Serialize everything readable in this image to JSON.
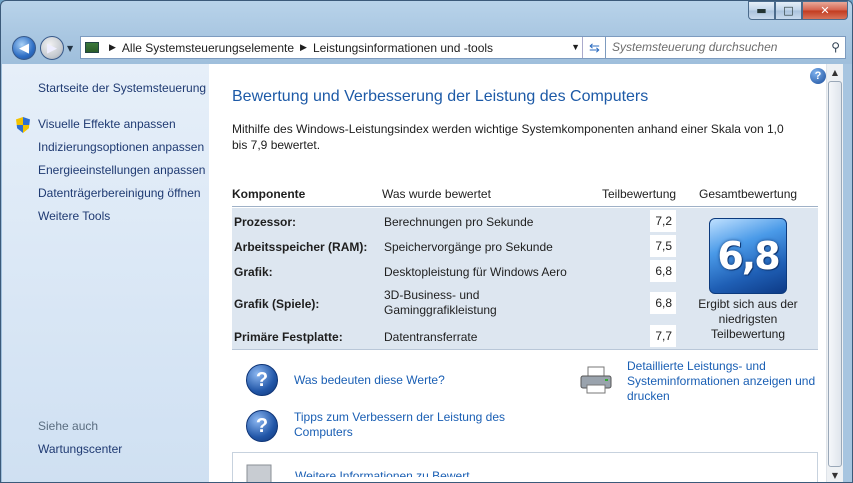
{
  "window": {
    "min": "▬",
    "max": "□",
    "close": "✕"
  },
  "nav": {
    "back_icon": "back-arrow-icon",
    "forward_icon": "forward-arrow-icon",
    "breadcrumb": [
      "Alle Systemsteuerungselemente",
      "Leistungsinformationen und -tools"
    ],
    "search_placeholder": "Systemsteuerung durchsuchen"
  },
  "sidebar": {
    "items": [
      {
        "label": "Startseite der Systemsteuerung"
      },
      {
        "label": "Visuelle Effekte anpassen"
      },
      {
        "label": "Indizierungsoptionen anpassen"
      },
      {
        "label": "Energieeinstellungen anpassen"
      },
      {
        "label": "Datenträgerbereinigung öffnen"
      },
      {
        "label": "Weitere Tools"
      }
    ],
    "see_also": "Siehe auch",
    "see_also_items": [
      {
        "label": "Wartungscenter"
      }
    ]
  },
  "main": {
    "title": "Bewertung und Verbesserung der Leistung des Computers",
    "description": "Mithilfe des Windows-Leistungsindex werden wichtige Systemkomponenten anhand einer Skala von 1,0 bis 7,9 bewertet.",
    "table": {
      "headers": [
        "Komponente",
        "Was wurde bewertet",
        "Teilbewertung",
        "Gesamtbewertung"
      ],
      "rows": [
        {
          "component": "Prozessor:",
          "what": "Berechnungen pro Sekunde",
          "score": "7,2"
        },
        {
          "component": "Arbeitsspeicher (RAM):",
          "what": "Speichervorgänge pro Sekunde",
          "score": "7,5"
        },
        {
          "component": "Grafik:",
          "what": "Desktopleistung für Windows Aero",
          "score": "6,8"
        },
        {
          "component": "Grafik (Spiele):",
          "what": "3D-Business- und Gaminggrafikleistung",
          "what_line1": "3D-Business- und",
          "what_line2": "Gaminggrafikleistung",
          "score": "6,8"
        },
        {
          "component": "Primäre Festplatte:",
          "what": "Datentransferrate",
          "score": "7,7"
        }
      ],
      "total_score": "6,8",
      "total_caption": "Ergibt sich aus der niedrigsten Teilbewertung"
    },
    "links": {
      "what_mean": "Was bedeuten diese Werte?",
      "tips": "Tipps zum Verbessern der Leistung des Computers",
      "details": "Detaillierte Leistungs- und Systeminformationen anzeigen und drucken",
      "more": "Weitere Informationen zu Bewert..."
    }
  }
}
